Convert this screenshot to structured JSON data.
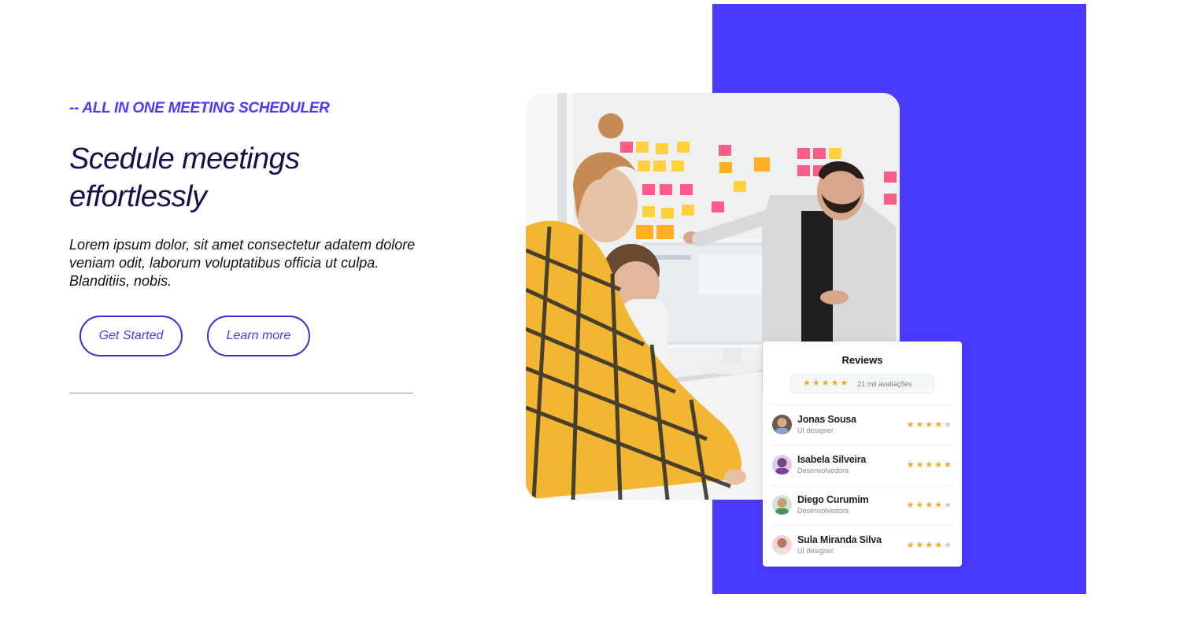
{
  "hero": {
    "eyebrow": "-- ALL IN ONE MEETING SCHEDULER",
    "headline": "Scedule meetings effortlessly",
    "intro": "Lorem ipsum dolor, sit amet consectetur adatem dolore veniam odit, laborum voluptatibus officia ut culpa. Blanditiis, nobis.",
    "primary_button": "Get Started",
    "secondary_button": "Learn more"
  },
  "colors": {
    "accent": "#4a3aff",
    "heading": "#170f49",
    "star": "#f5a623",
    "star_empty": "#c8c8c8"
  },
  "reviews": {
    "title": "Reviews",
    "summary_rating": 4.5,
    "summary_text": "21 mil avaliações",
    "items": [
      {
        "name": "Jonas Sousa",
        "role": "UI designer",
        "rating": 4
      },
      {
        "name": "Isabela Silveira",
        "role": "Desenvolvedora",
        "rating": 5
      },
      {
        "name": "Diego Curumim",
        "role": "Desenvolvedora",
        "rating": 4
      },
      {
        "name": "Sula Miranda Silva",
        "role": "UI designer",
        "rating": 4
      }
    ]
  },
  "icons": {
    "star": "star-icon",
    "avatar": "avatar-icon",
    "photo": "meeting-photo"
  }
}
